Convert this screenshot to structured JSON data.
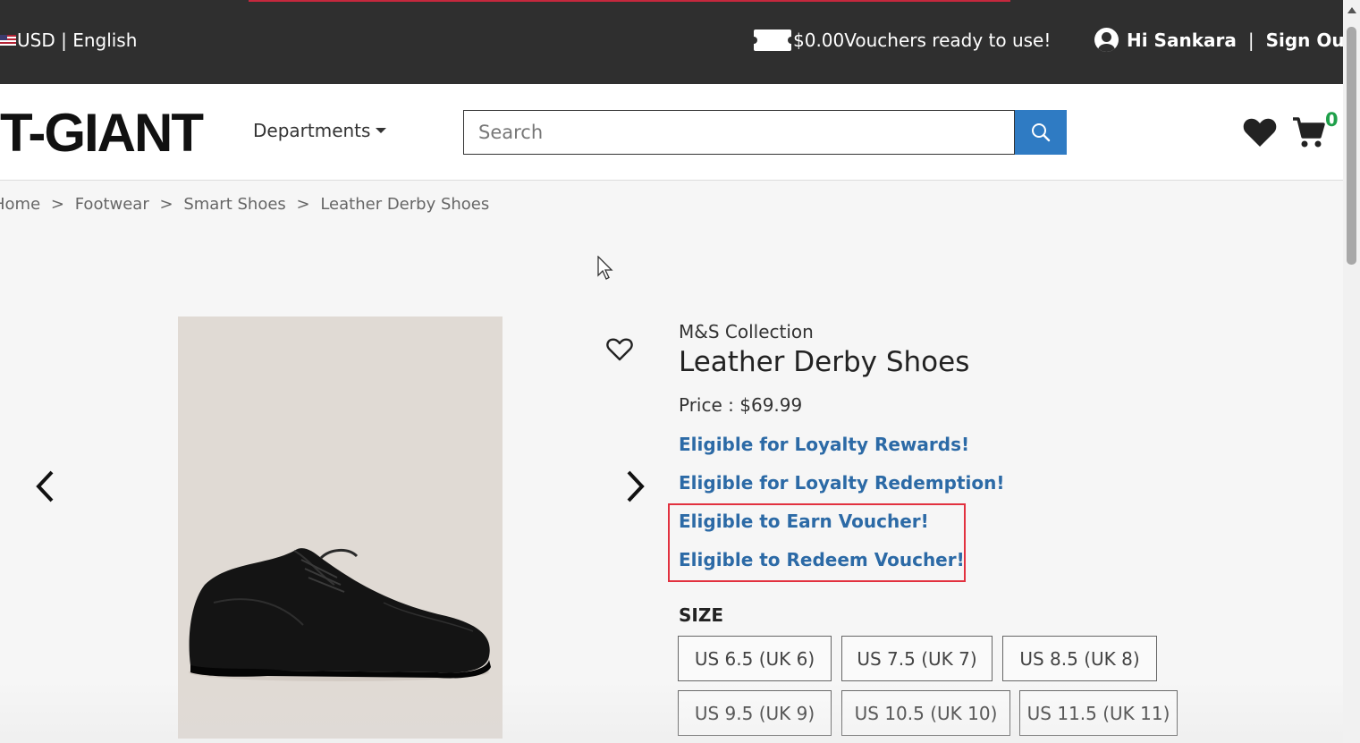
{
  "topbar": {
    "locale": "USD | English",
    "voucher_amount": "$0.00",
    "voucher_text": "Vouchers ready to use!",
    "greeting": "Hi Sankara",
    "separator": "|",
    "sign_out": "Sign Out"
  },
  "header": {
    "logo": "T-GIANT",
    "departments": "Departments",
    "search_placeholder": "Search",
    "cart_count": "0"
  },
  "breadcrumb": [
    "Home",
    ">",
    "Footwear",
    ">",
    "Smart Shoes",
    ">",
    "Leather Derby Shoes"
  ],
  "product": {
    "brand": "M&S Collection",
    "title": "Leather Derby Shoes",
    "price": "Price : $69.99",
    "eligibility": [
      "Eligible for Loyalty Rewards!",
      "Eligible for Loyalty Redemption!",
      "Eligible to Earn Voucher!",
      "Eligible to Redeem Voucher!"
    ],
    "size_label": "SIZE",
    "sizes": [
      "US 6.5 (UK 6)",
      "US 7.5 (UK 7)",
      "US 8.5 (UK 8)",
      "US 9.5 (UK 9)",
      "US 10.5 (UK 10)",
      "US 11.5 (UK 11)"
    ]
  },
  "colors": {
    "topbar_bg": "#2f2f2f",
    "link_blue": "#2c6aa6",
    "search_button": "#2f7bc3",
    "cart_count": "#1fa04a",
    "highlight": "#e2313f"
  }
}
